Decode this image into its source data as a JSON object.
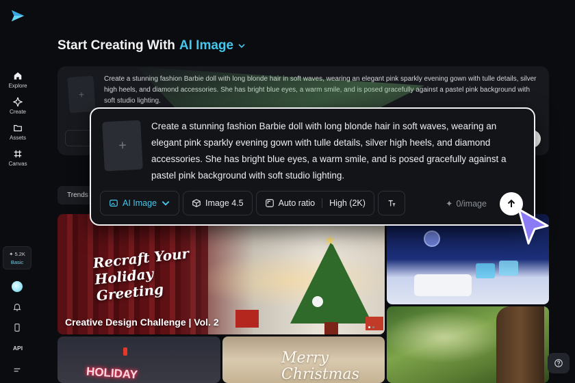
{
  "sidebar": {
    "logo_icon": "paper-plane-logo-icon",
    "items": [
      {
        "label": "Explore",
        "icon": "home-icon"
      },
      {
        "label": "Create",
        "icon": "sparkle-icon"
      },
      {
        "label": "Assets",
        "icon": "folder-icon"
      },
      {
        "label": "Canvas",
        "icon": "grid-hash-icon"
      }
    ],
    "credits": {
      "count": "5.2K",
      "plan": "Basic"
    },
    "api_label": "API"
  },
  "header": {
    "title_prefix": "Start Creating With",
    "title_accent": "AI Image",
    "accent_color": "#44c8ee"
  },
  "prompt_card": {
    "text": "Create a stunning fashion Barbie doll with long blonde hair in soft waves, wearing an elegant pink sparkly evening gown with tulle details, silver high heels, and diamond accessories. She has bright blue eyes, a warm smile, and is posed gracefully against a pastel pink background with soft studio lighting.",
    "thumb_icon": "+"
  },
  "tabs": {
    "trends": "Trends"
  },
  "gallery": {
    "main_script": "Recraft Your Holiday Greeting",
    "main_caption": "Creative Design Challenge | Vol. 2",
    "holiday_text": "HOLIDAY",
    "merry_text": "Merry Christmas"
  },
  "popup": {
    "thumb_icon": "+",
    "prompt": "Create a stunning fashion Barbie doll with long blonde hair in soft waves, wearing an elegant pink sparkly evening gown with tulle details, silver high heels, and diamond accessories. She has bright blue eyes, a warm smile, and is posed gracefully against a pastel pink background with soft studio lighting.",
    "mode_label": "AI Image",
    "model_label": "Image 4.5",
    "ratio_label": "Auto ratio",
    "quality_label": "High (2K)",
    "cost_label": "0/image"
  }
}
